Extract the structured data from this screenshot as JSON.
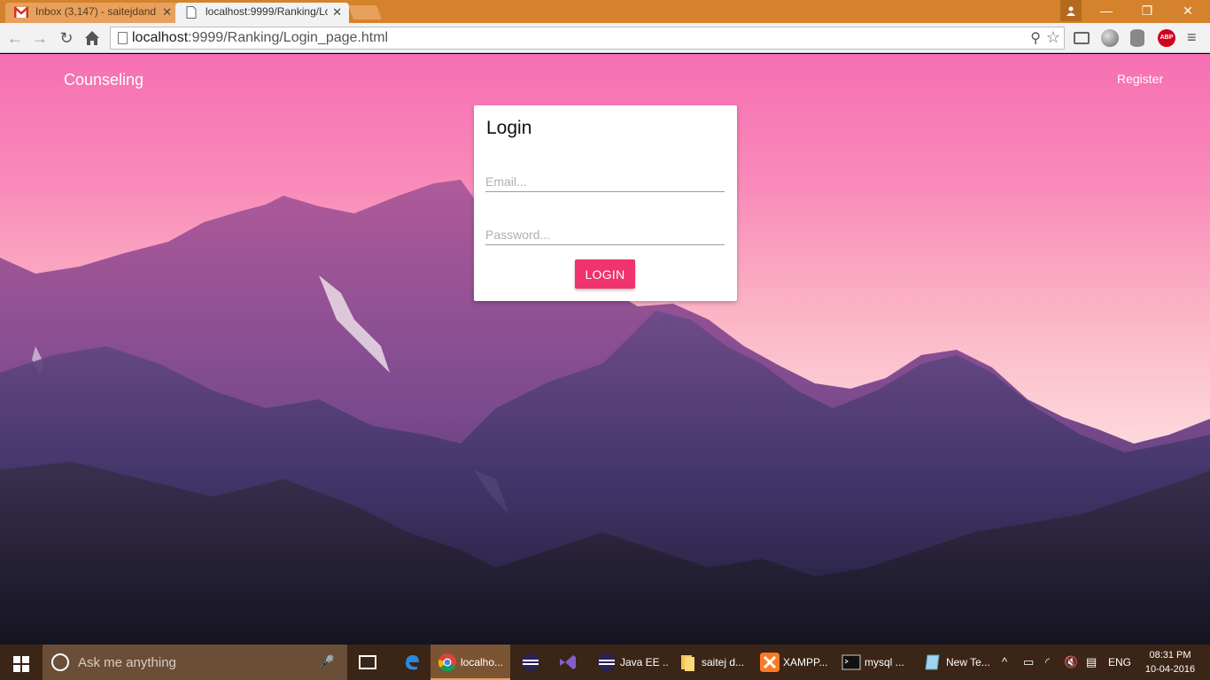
{
  "browser": {
    "tabs": [
      {
        "label": "Inbox (3,147) - saitejdand",
        "icon": "gmail-icon",
        "active": false
      },
      {
        "label": "localhost:9999/Ranking/Lo",
        "icon": "page-icon",
        "active": true
      }
    ],
    "url_host": "localhost",
    "url_rest": ":9999/Ranking/Login_page.html",
    "abp_label": "ABP"
  },
  "page": {
    "brand": "Counseling",
    "register": "Register",
    "login": {
      "title": "Login",
      "email_placeholder": "Email...",
      "password_placeholder": "Password...",
      "button": "LOGIN"
    },
    "colors": {
      "accent": "#f0326e",
      "tab_bar": "#d4822c"
    }
  },
  "taskbar": {
    "search_placeholder": "Ask me anything",
    "apps": [
      {
        "label": "",
        "icon": "edge-icon"
      },
      {
        "label": "localho...",
        "icon": "chrome-icon",
        "active": true
      },
      {
        "label": "",
        "icon": "eclipse-icon"
      },
      {
        "label": "",
        "icon": "visual-studio-icon"
      },
      {
        "label": "Java EE ...",
        "icon": "eclipse-icon"
      },
      {
        "label": "saitej d...",
        "icon": "folder-icon"
      },
      {
        "label": "XAMPP...",
        "icon": "xampp-icon"
      },
      {
        "label": "mysql ...",
        "icon": "cmd-icon"
      },
      {
        "label": "New Te...",
        "icon": "notepad-icon"
      }
    ],
    "language": "ENG",
    "time": "08:31 PM",
    "date": "10-04-2016"
  }
}
